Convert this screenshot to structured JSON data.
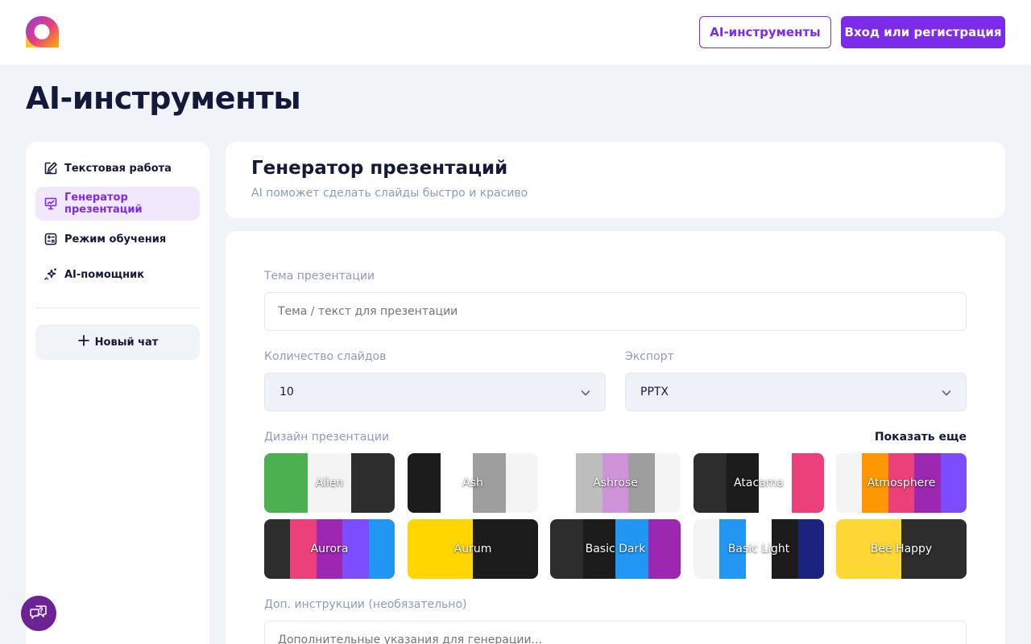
{
  "header": {
    "tools_button": "AI-инструменты",
    "login_button": "Вход или регистрация"
  },
  "page_title": "AI-инструменты",
  "sidebar": {
    "items": [
      {
        "label": "Текстовая работа",
        "icon": "edit-icon",
        "active": false
      },
      {
        "label": "Генератор презентаций",
        "icon": "presentation-icon",
        "active": true
      },
      {
        "label": "Режим обучения",
        "icon": "calculator-icon",
        "active": false
      },
      {
        "label": "AI-помощник",
        "icon": "sparkles-icon",
        "active": false
      }
    ],
    "new_chat": "Новый чат"
  },
  "tool": {
    "title": "Генератор презентаций",
    "subtitle": "AI поможет сделать слайды быстро и красиво"
  },
  "form": {
    "topic_label": "Тема презентации",
    "topic_placeholder": "Тема / текст для презентации",
    "slides_label": "Количество слайдов",
    "slides_value": "10",
    "export_label": "Экспорт",
    "export_value": "PPTX",
    "design_label": "Дизайн презентации",
    "show_more": "Показать еще",
    "extra_label": "Доп. инструкции (необязательно)",
    "extra_placeholder": "Дополнительные указания для генерации..."
  },
  "themes": [
    {
      "name": "Alien",
      "colors": [
        "#4caf50",
        "#f4f4f4",
        "#2d2d2d"
      ]
    },
    {
      "name": "Ash",
      "colors": [
        "#1c1c1c",
        "#ffffff",
        "#9e9e9e",
        "#f4f4f4"
      ]
    },
    {
      "name": "Ashrose",
      "colors": [
        "#ffffff",
        "#bdbdbd",
        "#ce93d8",
        "#9e9e9e",
        "#f4f4f4"
      ]
    },
    {
      "name": "Atacama",
      "colors": [
        "#2d2d2d",
        "#1c1c1c",
        "#ffffff",
        "#ec407a"
      ]
    },
    {
      "name": "Atmosphere",
      "colors": [
        "#f4f4f4",
        "#ff9800",
        "#ec407a",
        "#9c27b0",
        "#7c4dff"
      ]
    },
    {
      "name": "Aurora",
      "colors": [
        "#2d2d2d",
        "#ec407a",
        "#9c27b0",
        "#7c4dff",
        "#2196f3"
      ]
    },
    {
      "name": "Aurum",
      "colors": [
        "#ffd600",
        "#1c1c1c"
      ]
    },
    {
      "name": "Basic Dark",
      "colors": [
        "#2d2d2d",
        "#1c1c1c",
        "#2196f3",
        "#9c27b0"
      ]
    },
    {
      "name": "Basic Light",
      "colors": [
        "#f4f4f4",
        "#2196f3",
        "#ffffff",
        "#1c1c1c",
        "#1a237e"
      ]
    },
    {
      "name": "Bee Happy",
      "colors": [
        "#fdd835",
        "#2d2d2d"
      ]
    }
  ],
  "colors": {
    "accent": "#7c2be8",
    "accent_light": "#f1e8fc",
    "text_dark": "#14193a",
    "text_muted": "#8f9abb",
    "background": "#f0f3f8",
    "help_fab": "#6b2393"
  }
}
